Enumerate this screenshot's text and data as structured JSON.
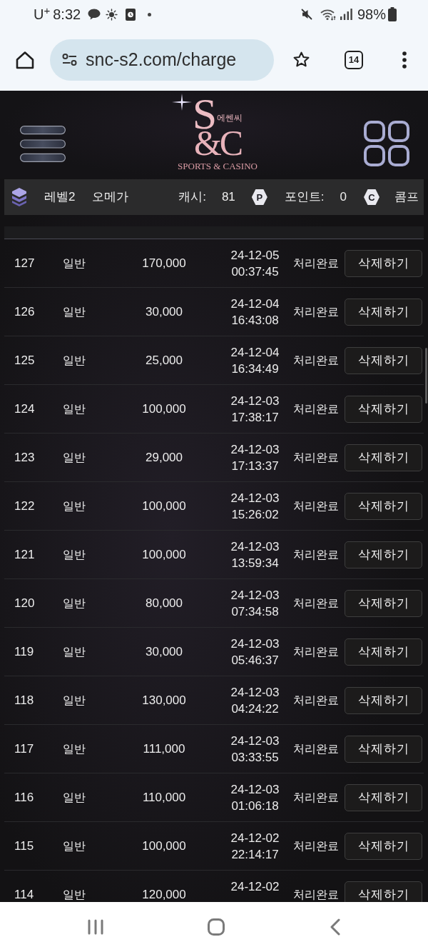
{
  "status_bar": {
    "carrier": "U$^{+}$",
    "time": "8:32",
    "battery": "98%"
  },
  "browser": {
    "url": "snc-s2.com/charge",
    "tab_count": "14"
  },
  "header": {
    "logo": {
      "monogram_top": "S",
      "korean": "에쎈씨",
      "monogram_bottom": "&C",
      "tagline": "SPORTS & CASINO"
    }
  },
  "user_bar": {
    "level": "레벨2",
    "nickname": "오메가",
    "cash_label": "캐시:",
    "cash": "81",
    "point_badge": "P",
    "points_label": "포인트:",
    "points": "0",
    "comp_badge": "C",
    "comp": "콤프"
  },
  "table": {
    "rows": [
      {
        "no": "127",
        "type": "일반",
        "amount": "170,000",
        "date": "24-12-05",
        "time": "00:37:45",
        "status": "처리완료",
        "action": "삭제하기"
      },
      {
        "no": "126",
        "type": "일반",
        "amount": "30,000",
        "date": "24-12-04",
        "time": "16:43:08",
        "status": "처리완료",
        "action": "삭제하기"
      },
      {
        "no": "125",
        "type": "일반",
        "amount": "25,000",
        "date": "24-12-04",
        "time": "16:34:49",
        "status": "처리완료",
        "action": "삭제하기"
      },
      {
        "no": "124",
        "type": "일반",
        "amount": "100,000",
        "date": "24-12-03",
        "time": "17:38:17",
        "status": "처리완료",
        "action": "삭제하기"
      },
      {
        "no": "123",
        "type": "일반",
        "amount": "29,000",
        "date": "24-12-03",
        "time": "17:13:37",
        "status": "처리완료",
        "action": "삭제하기"
      },
      {
        "no": "122",
        "type": "일반",
        "amount": "100,000",
        "date": "24-12-03",
        "time": "15:26:02",
        "status": "처리완료",
        "action": "삭제하기"
      },
      {
        "no": "121",
        "type": "일반",
        "amount": "100,000",
        "date": "24-12-03",
        "time": "13:59:34",
        "status": "처리완료",
        "action": "삭제하기"
      },
      {
        "no": "120",
        "type": "일반",
        "amount": "80,000",
        "date": "24-12-03",
        "time": "07:34:58",
        "status": "처리완료",
        "action": "삭제하기"
      },
      {
        "no": "119",
        "type": "일반",
        "amount": "30,000",
        "date": "24-12-03",
        "time": "05:46:37",
        "status": "처리완료",
        "action": "삭제하기"
      },
      {
        "no": "118",
        "type": "일반",
        "amount": "130,000",
        "date": "24-12-03",
        "time": "04:24:22",
        "status": "처리완료",
        "action": "삭제하기"
      },
      {
        "no": "117",
        "type": "일반",
        "amount": "111,000",
        "date": "24-12-03",
        "time": "03:33:55",
        "status": "처리완료",
        "action": "삭제하기"
      },
      {
        "no": "116",
        "type": "일반",
        "amount": "110,000",
        "date": "24-12-03",
        "time": "01:06:18",
        "status": "처리완료",
        "action": "삭제하기"
      },
      {
        "no": "115",
        "type": "일반",
        "amount": "100,000",
        "date": "24-12-02",
        "time": "22:14:17",
        "status": "처리완료",
        "action": "삭제하기"
      },
      {
        "no": "114",
        "type": "일반",
        "amount": "120,000",
        "date": "24-12-02",
        "status": "처리완료",
        "action": "삭제하기"
      }
    ]
  }
}
